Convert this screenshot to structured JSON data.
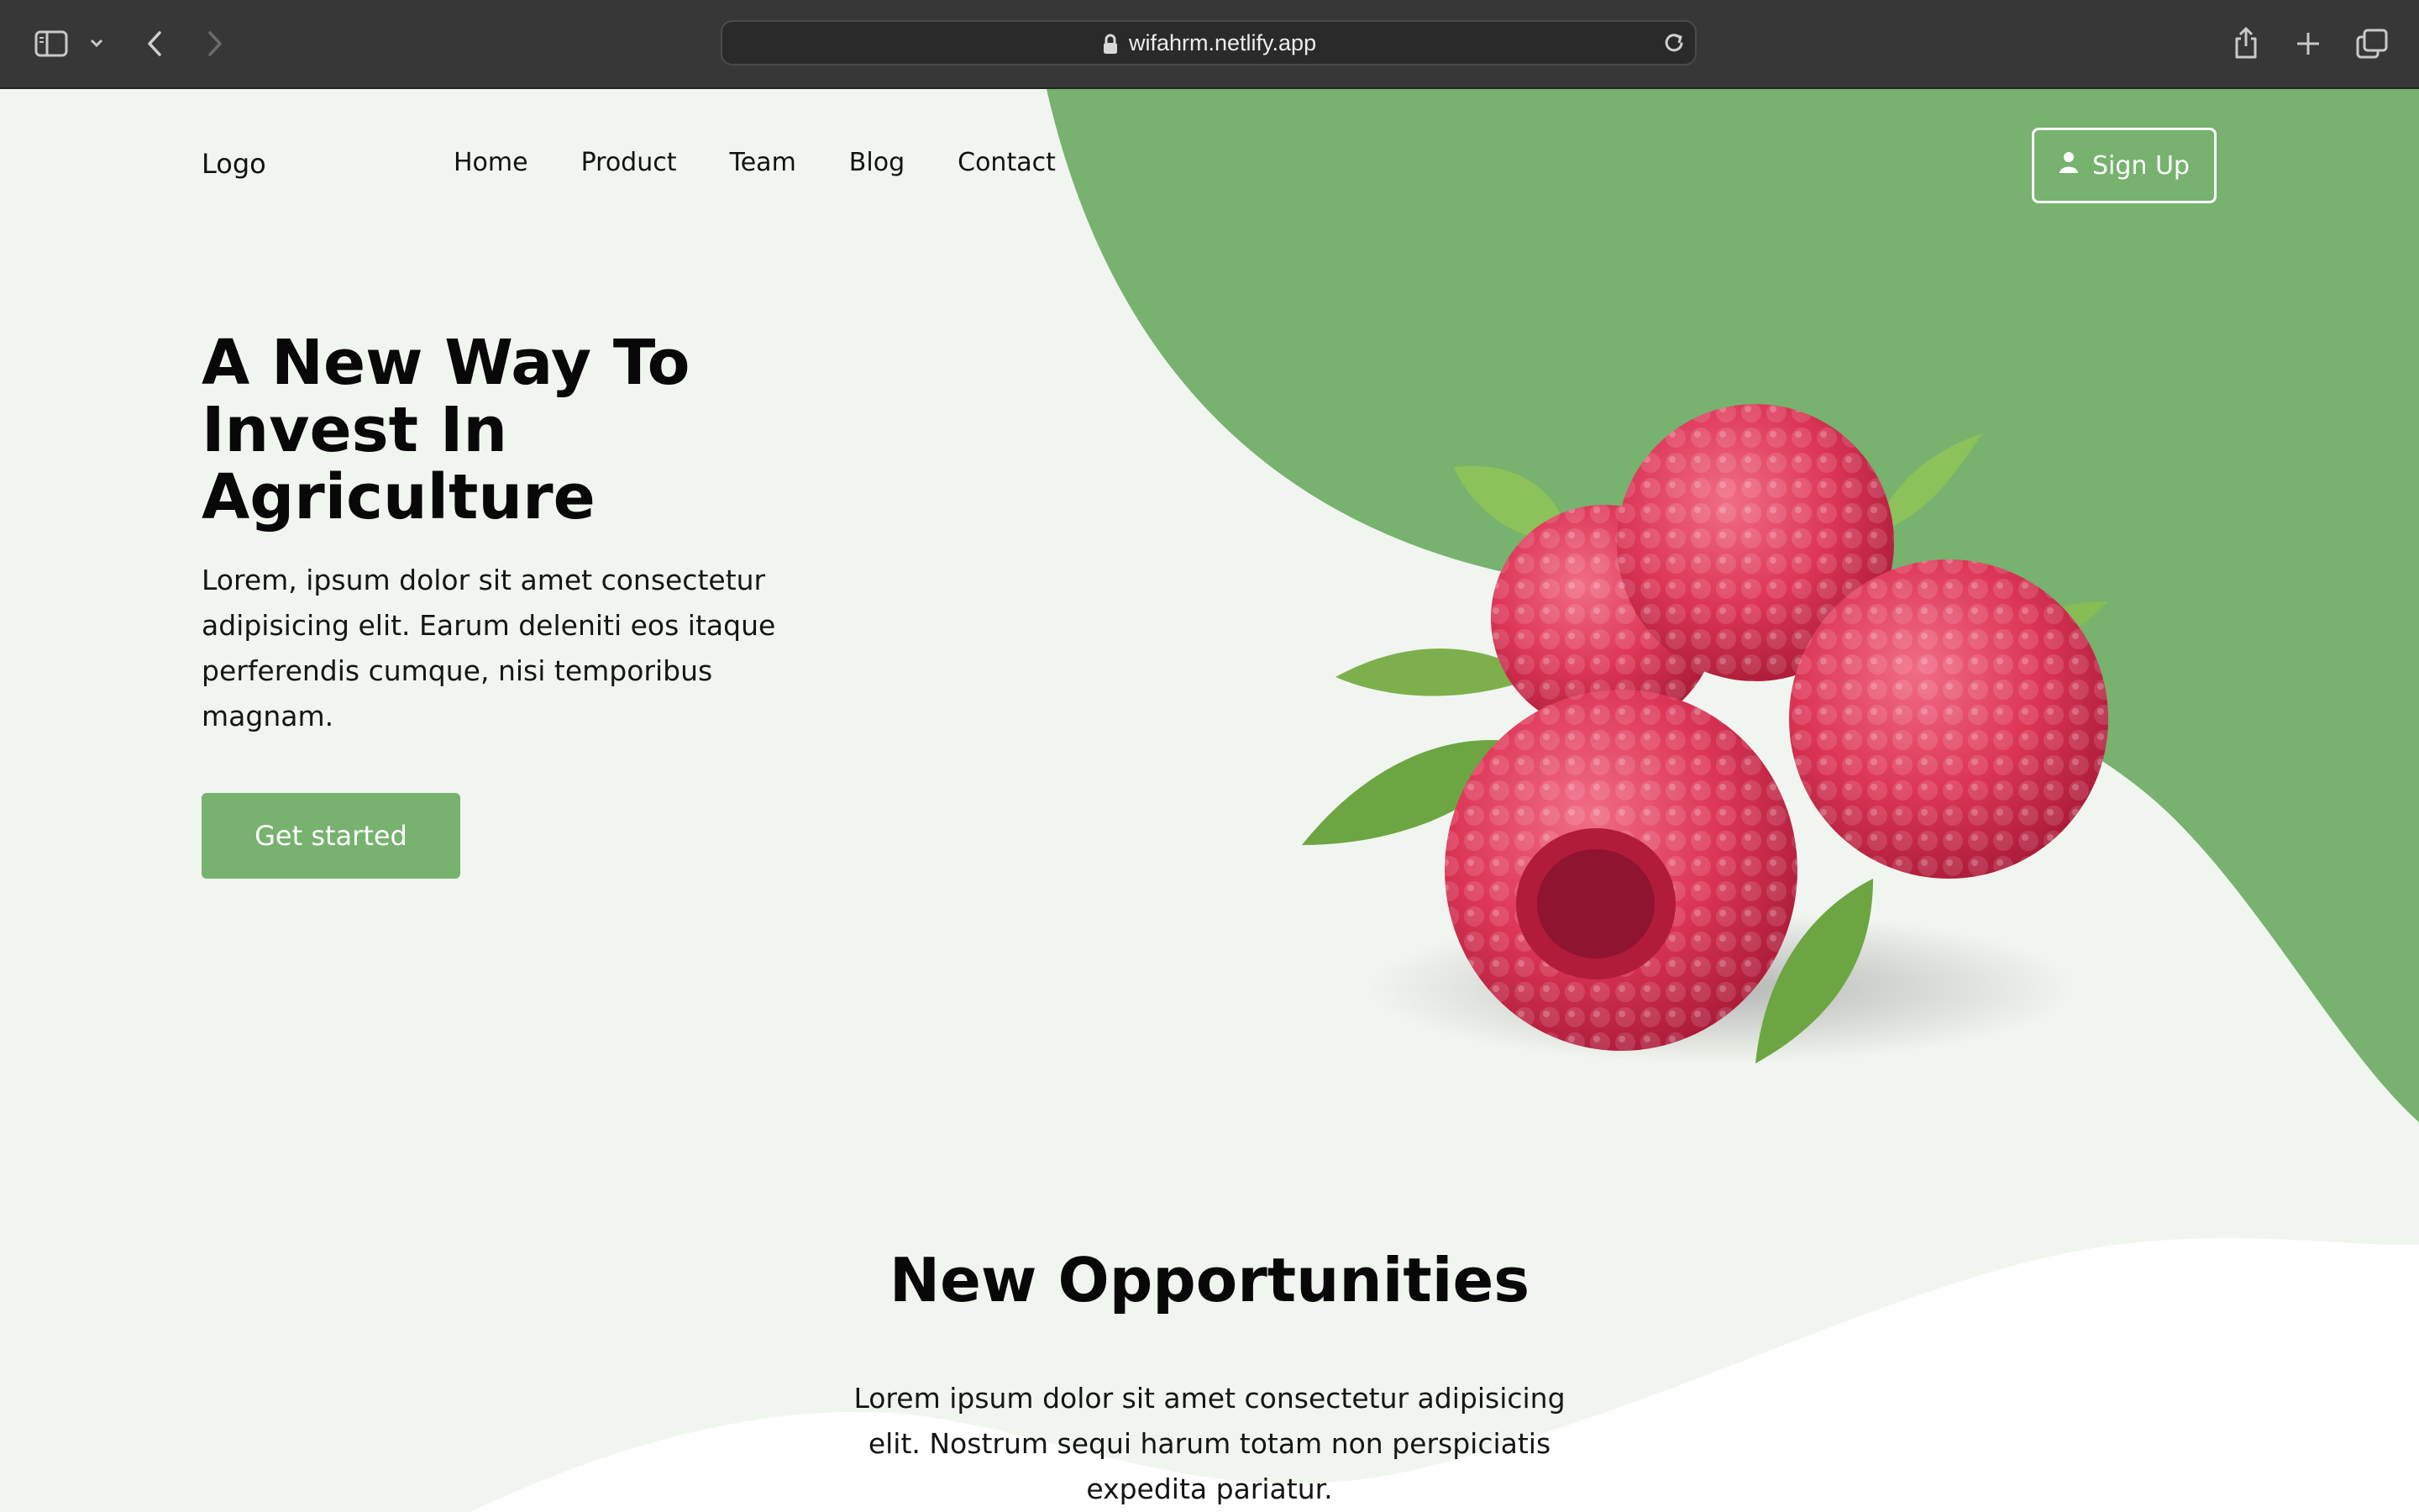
{
  "browser": {
    "url": "wifahrm.netlify.app",
    "icons": [
      "sidebar-icon",
      "chevron-down-icon",
      "back-icon",
      "forward-icon",
      "lock-icon",
      "reload-icon",
      "share-icon",
      "new-tab-icon",
      "tabs-overview-icon"
    ]
  },
  "header": {
    "logo": "Logo",
    "nav": [
      "Home",
      "Product",
      "Team",
      "Blog",
      "Contact"
    ],
    "signup_label": "Sign Up",
    "signup_icon": "user-icon"
  },
  "hero": {
    "title": "A New Way To Invest In Agriculture",
    "text": "Lorem, ipsum dolor sit amet consectetur adipisicing elit. Earum deleniti eos itaque perferendis cumque, nisi temporibus magnam.",
    "cta_label": "Get started",
    "image": "raspberries-image"
  },
  "opportunities": {
    "title": "New Opportunities",
    "text": "Lorem ipsum dolor sit amet consectetur adipisicing elit. Nostrum sequi harum totam non perspiciatis expedita pariatur."
  },
  "colors": {
    "accent_green": "#77b26f",
    "page_background": "#f1f5ef",
    "chrome_background": "#373737"
  }
}
